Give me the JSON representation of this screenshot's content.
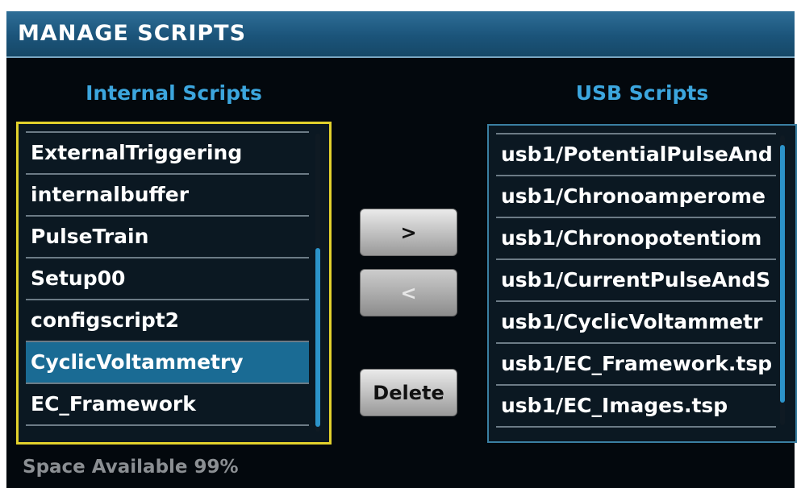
{
  "title": "MANAGE SCRIPTS",
  "internal": {
    "heading": "Internal Scripts",
    "items": [
      {
        "label": "ExternalTriggering",
        "selected": false
      },
      {
        "label": "internalbuffer",
        "selected": false
      },
      {
        "label": "PulseTrain",
        "selected": false
      },
      {
        "label": "Setup00",
        "selected": false
      },
      {
        "label": "configscript2",
        "selected": false
      },
      {
        "label": "CyclicVoltammetry",
        "selected": true
      },
      {
        "label": "EC_Framework",
        "selected": false
      }
    ]
  },
  "usb": {
    "heading": "USB Scripts",
    "items": [
      {
        "label": "usb1/PotentialPulseAnd"
      },
      {
        "label": "usb1/Chronoamperome"
      },
      {
        "label": "usb1/Chronopotentiom"
      },
      {
        "label": "usb1/CurrentPulseAndS"
      },
      {
        "label": "usb1/CyclicVoltammetr"
      },
      {
        "label": "usb1/EC_Framework.tsp"
      },
      {
        "label": "usb1/EC_Images.tsp"
      }
    ]
  },
  "buttons": {
    "copy_to_usb": ">",
    "copy_to_internal": "<",
    "copy_to_internal_enabled": false,
    "delete": "Delete"
  },
  "space": {
    "label": "Space Available",
    "value": "99%"
  },
  "colors": {
    "background": "#03080d",
    "title_bar": "#1b547a",
    "heading": "#3ca6de",
    "selected_row": "#1a6b94",
    "focus_border": "#e2d12c",
    "scroll_thumb": "#2c93c9"
  }
}
